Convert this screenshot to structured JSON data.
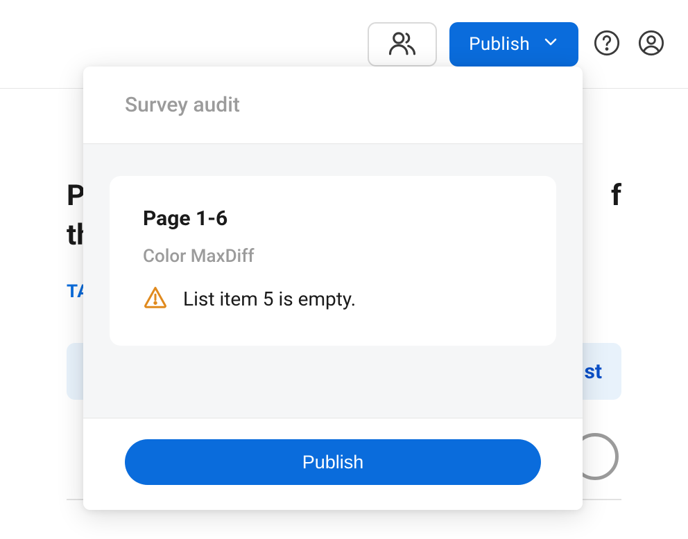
{
  "topbar": {
    "publish_label": "Publish"
  },
  "background": {
    "heading_line1": "P",
    "heading_line2": "th",
    "heading_suffix": "f",
    "tag_label": "TA",
    "band_suffix": "st"
  },
  "modal": {
    "title": "Survey audit",
    "card": {
      "page_label": "Page 1-6",
      "question_label": "Color MaxDiff",
      "warning_text": "List item 5 is empty."
    },
    "publish_button": "Publish"
  }
}
